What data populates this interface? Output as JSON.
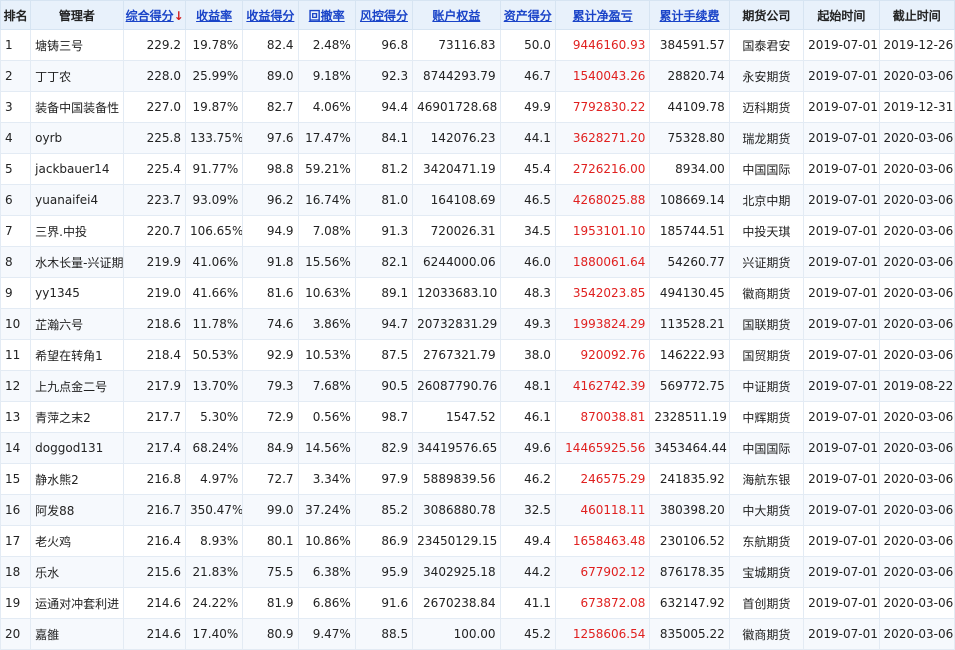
{
  "table": {
    "sort_arrow": "↓",
    "headers": [
      {
        "label": "排名"
      },
      {
        "label": "管理者"
      },
      {
        "label": "综合得分"
      },
      {
        "label": "收益率"
      },
      {
        "label": "收益得分"
      },
      {
        "label": "回撤率"
      },
      {
        "label": "风控得分"
      },
      {
        "label": "账户权益"
      },
      {
        "label": "资产得分"
      },
      {
        "label": "累计净盈亏"
      },
      {
        "label": "累计手续费"
      },
      {
        "label": "期货公司"
      },
      {
        "label": "起始时间"
      },
      {
        "label": "截止时间"
      }
    ],
    "rows": [
      [
        "1",
        "塘铸三号",
        "229.2",
        "19.78%",
        "82.4",
        "2.48%",
        "96.8",
        "73116.83",
        "50.0",
        "9446160.93",
        "384591.57",
        "国泰君安",
        "2019-07-01",
        "2019-12-26"
      ],
      [
        "2",
        "丁丁农",
        "228.0",
        "25.99%",
        "89.0",
        "9.18%",
        "92.3",
        "8744293.79",
        "46.7",
        "1540043.26",
        "28820.74",
        "永安期货",
        "2019-07-01",
        "2020-03-06"
      ],
      [
        "3",
        "装备中国装备性",
        "227.0",
        "19.87%",
        "82.7",
        "4.06%",
        "94.4",
        "46901728.68",
        "49.9",
        "7792830.22",
        "44109.78",
        "迈科期货",
        "2019-07-01",
        "2019-12-31"
      ],
      [
        "4",
        "oyrb",
        "225.8",
        "133.75%",
        "97.6",
        "17.47%",
        "84.1",
        "142076.23",
        "44.1",
        "3628271.20",
        "75328.80",
        "瑞龙期货",
        "2019-07-01",
        "2020-03-06"
      ],
      [
        "5",
        "jackbauer14",
        "225.4",
        "91.77%",
        "98.8",
        "59.21%",
        "81.2",
        "3420471.19",
        "45.4",
        "2726216.00",
        "8934.00",
        "中国国际",
        "2019-07-01",
        "2020-03-06"
      ],
      [
        "6",
        "yuanaifei4",
        "223.7",
        "93.09%",
        "96.2",
        "16.74%",
        "81.0",
        "164108.69",
        "46.5",
        "4268025.88",
        "108669.14",
        "北京中期",
        "2019-07-01",
        "2020-03-06"
      ],
      [
        "7",
        "三界.中投",
        "220.7",
        "106.65%",
        "94.9",
        "7.08%",
        "91.3",
        "720026.31",
        "34.5",
        "1953101.10",
        "185744.51",
        "中投天琪",
        "2019-07-01",
        "2020-03-06"
      ],
      [
        "8",
        "水木长量-兴证期",
        "219.9",
        "41.06%",
        "91.8",
        "15.56%",
        "82.1",
        "6244000.06",
        "46.0",
        "1880061.64",
        "54260.77",
        "兴证期货",
        "2019-07-01",
        "2020-03-06"
      ],
      [
        "9",
        "yy1345",
        "219.0",
        "41.66%",
        "81.6",
        "10.63%",
        "89.1",
        "12033683.10",
        "48.3",
        "3542023.85",
        "494130.45",
        "徽商期货",
        "2019-07-01",
        "2020-03-06"
      ],
      [
        "10",
        "芷瀚六号",
        "218.6",
        "11.78%",
        "74.6",
        "3.86%",
        "94.7",
        "20732831.29",
        "49.3",
        "1993824.29",
        "113528.21",
        "国联期货",
        "2019-07-01",
        "2020-03-06"
      ],
      [
        "11",
        "希望在转角1",
        "218.4",
        "50.53%",
        "92.9",
        "10.53%",
        "87.5",
        "2767321.79",
        "38.0",
        "920092.76",
        "146222.93",
        "国贸期货",
        "2019-07-01",
        "2020-03-06"
      ],
      [
        "12",
        "上九点金二号",
        "217.9",
        "13.70%",
        "79.3",
        "7.68%",
        "90.5",
        "26087790.76",
        "48.1",
        "4162742.39",
        "569772.75",
        "中证期货",
        "2019-07-01",
        "2019-08-22"
      ],
      [
        "13",
        "青萍之末2",
        "217.7",
        "5.30%",
        "72.9",
        "0.56%",
        "98.7",
        "1547.52",
        "46.1",
        "870038.81",
        "2328511.19",
        "中辉期货",
        "2019-07-01",
        "2020-03-06"
      ],
      [
        "14",
        "doggod131",
        "217.4",
        "68.24%",
        "84.9",
        "14.56%",
        "82.9",
        "34419576.65",
        "49.6",
        "14465925.56",
        "3453464.44",
        "中国国际",
        "2019-07-01",
        "2020-03-06"
      ],
      [
        "15",
        "静水熊2",
        "216.8",
        "4.97%",
        "72.7",
        "3.34%",
        "97.9",
        "5889839.56",
        "46.2",
        "246575.29",
        "241835.92",
        "海航东银",
        "2019-07-01",
        "2020-03-06"
      ],
      [
        "16",
        "阿发88",
        "216.7",
        "350.47%",
        "99.0",
        "37.24%",
        "85.2",
        "3086880.78",
        "32.5",
        "460118.11",
        "380398.20",
        "中大期货",
        "2019-07-01",
        "2020-03-06"
      ],
      [
        "17",
        "老火鸡",
        "216.4",
        "8.93%",
        "80.1",
        "10.86%",
        "86.9",
        "23450129.15",
        "49.4",
        "1658463.48",
        "230106.52",
        "东航期货",
        "2019-07-01",
        "2020-03-06"
      ],
      [
        "18",
        "乐水",
        "215.6",
        "21.83%",
        "75.5",
        "6.38%",
        "95.9",
        "3402925.18",
        "44.2",
        "677902.12",
        "876178.35",
        "宝城期货",
        "2019-07-01",
        "2020-03-06"
      ],
      [
        "19",
        "运通对冲套利进",
        "214.6",
        "24.22%",
        "81.9",
        "6.86%",
        "91.6",
        "2670238.84",
        "41.1",
        "673872.08",
        "632147.92",
        "首创期货",
        "2019-07-01",
        "2020-03-06"
      ],
      [
        "20",
        "嘉雒",
        "214.6",
        "17.40%",
        "80.9",
        "9.47%",
        "88.5",
        "100.00",
        "45.2",
        "1258606.54",
        "835005.22",
        "徽商期货",
        "2019-07-01",
        "2020-03-06"
      ]
    ]
  }
}
